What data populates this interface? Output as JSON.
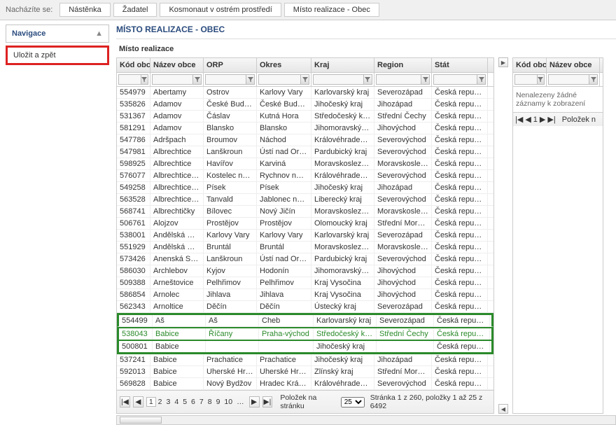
{
  "breadcrumb": {
    "label": "Nacházíte se:",
    "items": [
      "Nástěnka",
      "Žadatel",
      "Kosmonaut v ostrém prostředí",
      "Místo realizace - Obec"
    ]
  },
  "nav": {
    "title": "Navigace"
  },
  "save_back": "Uložit a zpět",
  "section_title": "MÍSTO REALIZACE - OBEC",
  "subsection": "Místo realizace",
  "main_headers": [
    "Kód obce",
    "Název obce",
    "ORP",
    "Okres",
    "Kraj",
    "Region",
    "Stát"
  ],
  "right_headers": [
    "Kód obce",
    "Název obce"
  ],
  "right_empty": "Nenalezeny žádné záznamy k zobrazení",
  "right_polozek": "Položek n",
  "rows": [
    {
      "c": [
        "554979",
        "Abertamy",
        "Ostrov",
        "Karlovy Vary",
        "Karlovarský kraj",
        "Severozápad",
        "Česká republika"
      ]
    },
    {
      "c": [
        "535826",
        "Adamov",
        "České Budějovice",
        "České Budějovice",
        "Jihočeský kraj",
        "Jihozápad",
        "Česká republika"
      ]
    },
    {
      "c": [
        "531367",
        "Adamov",
        "Čáslav",
        "Kutná Hora",
        "Středočeský kraj",
        "Střední Čechy",
        "Česká republika"
      ]
    },
    {
      "c": [
        "581291",
        "Adamov",
        "Blansko",
        "Blansko",
        "Jihomoravský kraj",
        "Jihovýchod",
        "Česká republika"
      ]
    },
    {
      "c": [
        "547786",
        "Adršpach",
        "Broumov",
        "Náchod",
        "Královéhradecký kraj",
        "Severovýchod",
        "Česká republika"
      ]
    },
    {
      "c": [
        "547981",
        "Albrechtice",
        "Lanškroun",
        "Ústí nad Orlicí",
        "Pardubický kraj",
        "Severovýchod",
        "Česká republika"
      ]
    },
    {
      "c": [
        "598925",
        "Albrechtice",
        "Havířov",
        "Karviná",
        "Moravskoslezský kraj",
        "Moravskoslezsko",
        "Česká republika"
      ]
    },
    {
      "c": [
        "576077",
        "Albrechtice nad…",
        "Kostelec nad Orlicí",
        "Rychnov nad Kně…",
        "Královéhradecký kraj",
        "Severovýchod",
        "Česká republika"
      ]
    },
    {
      "c": [
        "549258",
        "Albrechtice nad…",
        "Písek",
        "Písek",
        "Jihočeský kraj",
        "Jihozápad",
        "Česká republika"
      ]
    },
    {
      "c": [
        "563528",
        "Albrechtice v Jiz…",
        "Tanvald",
        "Jablonec nad Nis…",
        "Liberecký kraj",
        "Severovýchod",
        "Česká republika"
      ]
    },
    {
      "c": [
        "568741",
        "Albrechtičky",
        "Bílovec",
        "Nový Jičín",
        "Moravskoslezský kraj",
        "Moravskoslezsko",
        "Česká republika"
      ]
    },
    {
      "c": [
        "506761",
        "Alojzov",
        "Prostějov",
        "Prostějov",
        "Olomoucký kraj",
        "Střední Morava",
        "Česká republika"
      ]
    },
    {
      "c": [
        "538001",
        "Andělská Hora",
        "Karlovy Vary",
        "Karlovy Vary",
        "Karlovarský kraj",
        "Severozápad",
        "Česká republika"
      ]
    },
    {
      "c": [
        "551929",
        "Andělská Hora",
        "Bruntál",
        "Bruntál",
        "Moravskoslezský kraj",
        "Moravskoslezsko",
        "Česká republika"
      ]
    },
    {
      "c": [
        "573426",
        "Anenská Studánka",
        "Lanškroun",
        "Ústí nad Orlicí",
        "Pardubický kraj",
        "Severovýchod",
        "Česká republika"
      ]
    },
    {
      "c": [
        "586030",
        "Archlebov",
        "Kyjov",
        "Hodonín",
        "Jihomoravský kraj",
        "Jihovýchod",
        "Česká republika"
      ]
    },
    {
      "c": [
        "509388",
        "Arneštovice",
        "Pelhřimov",
        "Pelhřimov",
        "Kraj Vysočina",
        "Jihovýchod",
        "Česká republika"
      ]
    },
    {
      "c": [
        "586854",
        "Arnolec",
        "Jihlava",
        "Jihlava",
        "Kraj Vysočina",
        "Jihovýchod",
        "Česká republika"
      ]
    },
    {
      "c": [
        "562343",
        "Arnoltice",
        "Děčín",
        "Děčín",
        "Ústecký kraj",
        "Severozápad",
        "Česká republika"
      ]
    },
    {
      "c": [
        "554499",
        "Aš",
        "Aš",
        "Cheb",
        "Karlovarský kraj",
        "Severozápad",
        "Česká republika"
      ]
    },
    {
      "c": [
        "538043",
        "Babice",
        "Říčany",
        "Praha-východ",
        "Středočeský kraj",
        "Střední Čechy",
        "Česká republika"
      ],
      "hl": true
    },
    {
      "c": [
        "500801",
        "Babice",
        "",
        "",
        "Jihočeský kraj",
        "",
        "Česká republika"
      ]
    },
    {
      "c": [
        "537241",
        "Babice",
        "Prachatice",
        "Prachatice",
        "Jihočeský kraj",
        "Jihozápad",
        "Česká republika"
      ]
    },
    {
      "c": [
        "592013",
        "Babice",
        "Uherské Hradiště",
        "Uherské Hradiště",
        "Zlínský kraj",
        "Střední Morava",
        "Česká republika"
      ]
    },
    {
      "c": [
        "569828",
        "Babice",
        "Nový Bydžov",
        "Hradec Králové",
        "Královéhradecký kraj",
        "Severovýchod",
        "Česká republika"
      ]
    }
  ],
  "pager": {
    "pages": [
      "1",
      "2",
      "3",
      "4",
      "5",
      "6",
      "7",
      "8",
      "9",
      "10",
      "…"
    ],
    "current": "1",
    "per_page_label": "Položek na stránku",
    "per_page": "25",
    "summary": "Stránka 1 z 260, položky 1 až 25 z 6492"
  }
}
